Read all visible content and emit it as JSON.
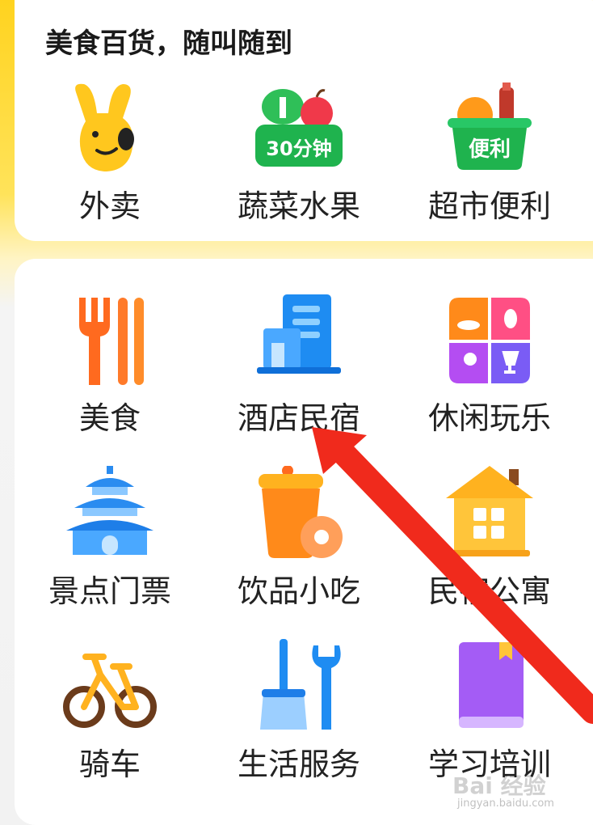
{
  "section1": {
    "title": "美食百货，随叫随到",
    "items": [
      {
        "label": "外卖",
        "icon": "kangaroo-icon"
      },
      {
        "label": "蔬菜水果",
        "icon": "vegetable-basket-icon",
        "badge": "30分钟"
      },
      {
        "label": "超市便利",
        "icon": "grocery-basket-icon",
        "badge": "便利"
      }
    ]
  },
  "section2": {
    "items": [
      {
        "label": "美食",
        "icon": "fork-chopsticks-icon"
      },
      {
        "label": "酒店民宿",
        "icon": "hotel-building-icon"
      },
      {
        "label": "休闲玩乐",
        "icon": "leisure-grid-icon"
      },
      {
        "label": "景点门票",
        "icon": "temple-icon"
      },
      {
        "label": "饮品小吃",
        "icon": "drink-donut-icon"
      },
      {
        "label": "民宿公寓",
        "icon": "house-icon"
      },
      {
        "label": "骑车",
        "icon": "bicycle-icon"
      },
      {
        "label": "生活服务",
        "icon": "broom-wrench-icon"
      },
      {
        "label": "学习培训",
        "icon": "book-icon"
      }
    ]
  },
  "watermark": {
    "brand": "Bai 经验",
    "url": "jingyan.baidu.com"
  },
  "colors": {
    "accent": "#ffd31f",
    "arrow": "#f02a1c"
  }
}
